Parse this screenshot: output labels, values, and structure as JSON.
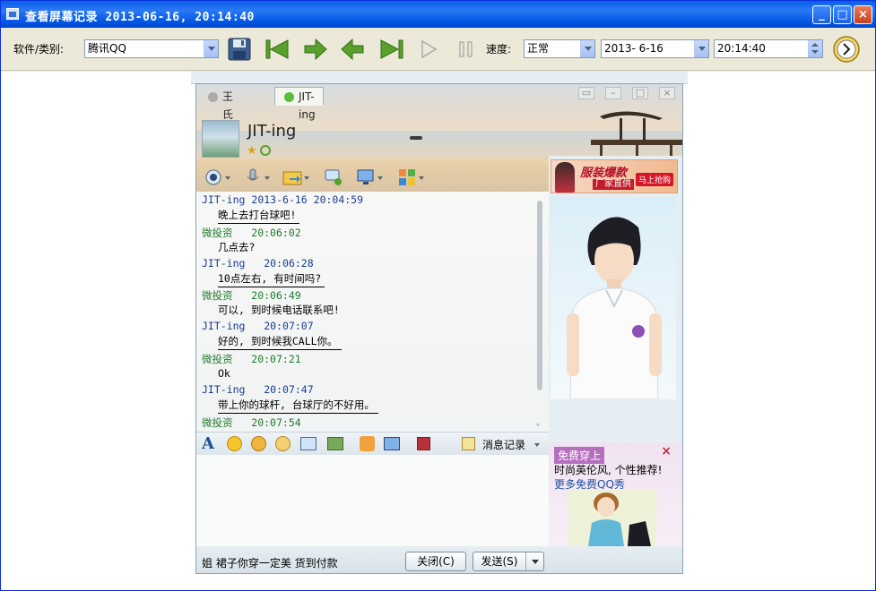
{
  "window": {
    "title": "查看屏幕记录  2013-06-16, 20:14:40",
    "buttons": {
      "minimize": "_",
      "maximize": "□",
      "close": "×"
    }
  },
  "toolbar": {
    "software_label": "软件/类别:",
    "software_value": "腾讯QQ",
    "speed_label": "速度:",
    "speed_value": "正常",
    "date_value": "2013- 6-16",
    "time_value": "20:14:40"
  },
  "qq": {
    "tabs": [
      "王氏门徒",
      "JIT-ing"
    ],
    "nickname": "JIT-ing",
    "messages": [
      {
        "sender": "JIT-ing",
        "time": "2013-6-16 20:04:59",
        "text": "晚上去打台球吧!",
        "underline": true,
        "color": "blue"
      },
      {
        "sender": "微投资",
        "time": "20:06:02",
        "text": "几点去?",
        "underline": false,
        "color": "green"
      },
      {
        "sender": "JIT-ing",
        "time": "20:06:28",
        "text": "10点左右, 有时间吗?",
        "underline": true,
        "color": "blue"
      },
      {
        "sender": "微投资",
        "time": "20:06:49",
        "text": "可以, 到时候电话联系吧!",
        "underline": false,
        "color": "green"
      },
      {
        "sender": "JIT-ing",
        "time": "20:07:07",
        "text": "好的, 到时候我CALL你。",
        "underline": true,
        "color": "blue"
      },
      {
        "sender": "微投资",
        "time": "20:07:21",
        "text": "Ok",
        "underline": false,
        "color": "green"
      },
      {
        "sender": "JIT-ing",
        "time": "20:07:47",
        "text": "带上你的球杆, 台球厅的不好用。",
        "underline": true,
        "color": "blue"
      },
      {
        "sender": "微投资",
        "time": "20:07:54",
        "text": "",
        "underline": false,
        "color": "green"
      }
    ],
    "message_log_label": "消息记录",
    "bottom_ad": "姐 裙子你穿一定美 货到付款",
    "close_button": "关闭(C)",
    "send_button": "发送(S)",
    "banner": {
      "line1": "服装爆款",
      "line2": "厂家直供",
      "cta": "马上抢购"
    },
    "free_panel": {
      "header": "免费穿上",
      "line1": "时尚英伦风, 个性推荐!",
      "line2": "更多免费QQ秀"
    }
  }
}
